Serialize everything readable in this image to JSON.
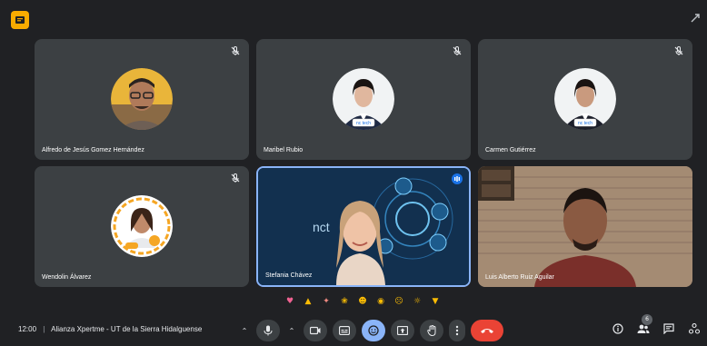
{
  "participants": [
    {
      "name": "Alfredo de Jesús Gomez Hernández",
      "muted": true
    },
    {
      "name": "Maribel Rubio",
      "muted": true,
      "logo_text": "nc tech"
    },
    {
      "name": "Carmen Gutiérrez",
      "muted": true,
      "logo_text": "nc tech"
    },
    {
      "name": "Wendolin Álvarez",
      "muted": true
    },
    {
      "name": "Stefania Chávez",
      "speaking": true,
      "presentation_text": "nct"
    },
    {
      "name": "Luis Alberto Ruiz Aguilar"
    }
  ],
  "reactions": [
    "sparkling-heart",
    "thumbs-up",
    "party-popper",
    "clapping-hands",
    "laughing-face",
    "surprised-face",
    "crying-face",
    "thinking-face",
    "thumbs-down"
  ],
  "meeting": {
    "time": "12:00",
    "title": "Alianza Xpertme - UT de la Sierra Hidalguense"
  },
  "people_count": "6",
  "colors": {
    "background": "#202124",
    "tile": "#3c4043",
    "speaking_border": "#8ab4f8",
    "end_call": "#ea4335",
    "app_badge": "#f9ab00"
  },
  "controls": [
    "mic-options",
    "microphone",
    "camera-options",
    "camera",
    "captions",
    "emoji",
    "present",
    "raise-hand",
    "more-options",
    "end-call"
  ],
  "right_controls": [
    "meeting-info",
    "people",
    "chat",
    "activities"
  ]
}
